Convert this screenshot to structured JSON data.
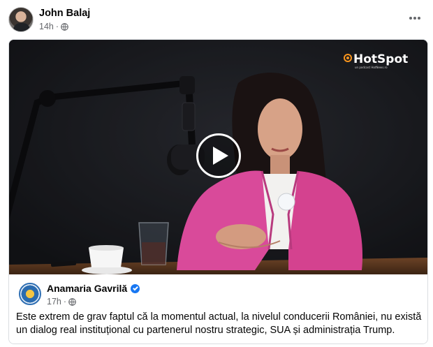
{
  "post": {
    "author": "John Balaj",
    "time": "14h",
    "more_icon": "more-horizontal-icon",
    "privacy_icon": "globe-icon"
  },
  "shared": {
    "watermark": "HotSpot",
    "watermark_tag": "un podcast HotNews.ro",
    "play_icon": "play-icon",
    "page_name": "Anamaria Gavrilă",
    "verified_icon": "verified-badge-icon",
    "time": "17h",
    "caption": "Este extrem de grav faptul că la momentul actual, la nivelul conducerii României, nu există un dialog real instituțional cu partenerul nostru strategic, SUA și administrația Trump."
  },
  "colors": {
    "accent": "#1877f2",
    "secondary_text": "#65676b",
    "blazer": "#d94a9a",
    "brand_orange": "#f7941d"
  }
}
